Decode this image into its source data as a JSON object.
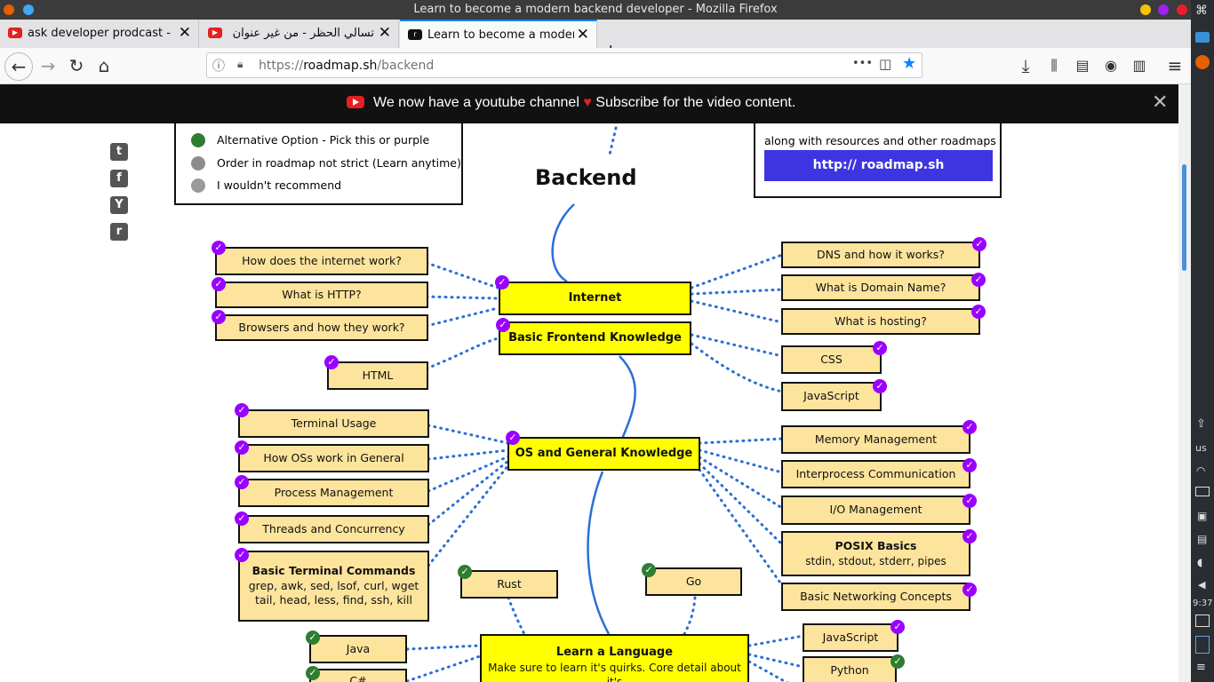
{
  "window": {
    "title": "Learn to become a modern backend developer - Mozilla Firefox"
  },
  "tabs": [
    {
      "label": "ask developer prodcast - YouTube",
      "active": false
    },
    {
      "label": "تسالي الحظر - من غير عنوان",
      "active": false
    },
    {
      "label": "Learn to become a modern backend",
      "active": true
    }
  ],
  "navbar": {
    "url_prefix": "https://",
    "url_domain": "roadmap.sh",
    "url_path": "/backend",
    "more": "•••"
  },
  "banner": {
    "part1": "We now have a youtube channel",
    "heart": "♥",
    "part2": "Subscribe for the video content.",
    "close": "✕"
  },
  "legend": {
    "items": [
      {
        "text": "Alternative Option - Pick this or purple",
        "color": "#2f7d31"
      },
      {
        "text": "Order in roadmap not strict (Learn anytime)",
        "color": "#8c8c8c"
      },
      {
        "text": "I wouldn't recommend",
        "color": "#9a9a9a"
      }
    ]
  },
  "infobox": {
    "text": "along with resources and other roadmaps",
    "link": "http:// roadmap.sh"
  },
  "social": [
    "t",
    "f",
    "Y",
    "r"
  ],
  "roadmap": {
    "title": "Backend",
    "internet": "Internet",
    "internet_subs": [
      "How does the internet work?",
      "What is HTTP?",
      "Browsers and how they work?"
    ],
    "internet_subs_right": [
      "DNS and how it works?",
      "What is Domain Name?",
      "What is hosting?"
    ],
    "frontend": "Basic Frontend Knowledge",
    "frontend_left": [
      "HTML"
    ],
    "frontend_right": [
      "CSS",
      "JavaScript"
    ],
    "os": "OS and General Knowledge",
    "os_left": [
      "Terminal Usage",
      "How OSs work in General",
      "Process Management",
      "Threads and Concurrency"
    ],
    "os_cmds_title": "Basic Terminal Commands",
    "os_cmds_line1": "grep, awk, sed, lsof, curl, wget",
    "os_cmds_line2": "tail, head, less, find, ssh, kill",
    "os_right": [
      "Memory Management",
      "Interprocess Communication",
      "I/O Management"
    ],
    "posix_title": "POSIX Basics",
    "posix_sub": "stdin, stdout, stderr, pipes",
    "os_right_last": "Basic Networking Concepts",
    "lang": "Learn a Language",
    "lang_sub": "Make sure to learn it's quirks. Core detail about it's",
    "langs": [
      "Rust",
      "Go",
      "Java",
      "JavaScript",
      "Python",
      "C#"
    ]
  },
  "systray": {
    "keyboard": "us",
    "time": "9:37"
  }
}
